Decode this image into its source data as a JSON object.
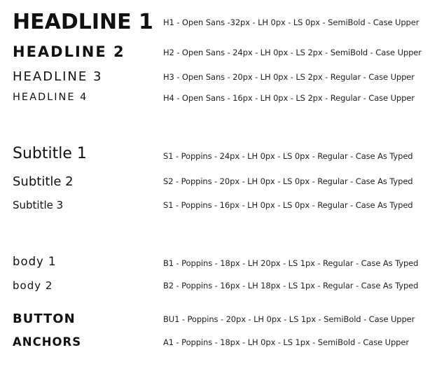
{
  "styles": [
    {
      "sample": "HEADLINE 1",
      "spec": "H1 - Open Sans -32px - LH 0px - LS 0px - SemiBold - Case Upper"
    },
    {
      "sample": "HEADLINE 2",
      "spec": "H2 - Open Sans - 24px - LH 0px - LS 2px - SemiBold - Case Upper"
    },
    {
      "sample": "HEADLINE 3",
      "spec": "H3 - Open Sans - 20px - LH 0px - LS 2px - Regular - Case Upper"
    },
    {
      "sample": "HEADLINE 4",
      "spec": "H4 - Open Sans - 16px - LH 0px - LS 2px - Regular - Case Upper"
    },
    {
      "sample": "Subtitle 1",
      "spec": "S1 - Poppins - 24px - LH 0px - LS 0px - Regular - Case As Typed"
    },
    {
      "sample": "Subtitle 2",
      "spec": "S2 - Poppins - 20px - LH 0px - LS 0px - Regular - Case As Typed"
    },
    {
      "sample": "Subtitle 3",
      "spec": "S1 - Poppins - 16px - LH 0px - LS 0px - Regular - Case As Typed"
    },
    {
      "sample": "body 1",
      "spec": "B1 - Poppins - 18px - LH 20px - LS 1px - Regular - Case As Typed"
    },
    {
      "sample": "body 2",
      "spec": "B2 - Poppins - 16px - LH 18px - LS 1px - Regular - Case As Typed"
    },
    {
      "sample": "BUTTON",
      "spec": "BU1 - Poppins - 20px - LH 0px - LS 1px - SemiBold - Case Upper"
    },
    {
      "sample": "ANCHORS",
      "spec": "A1 - Poppins - 18px - LH 0px - LS 1px - SemiBold - Case Upper"
    }
  ]
}
